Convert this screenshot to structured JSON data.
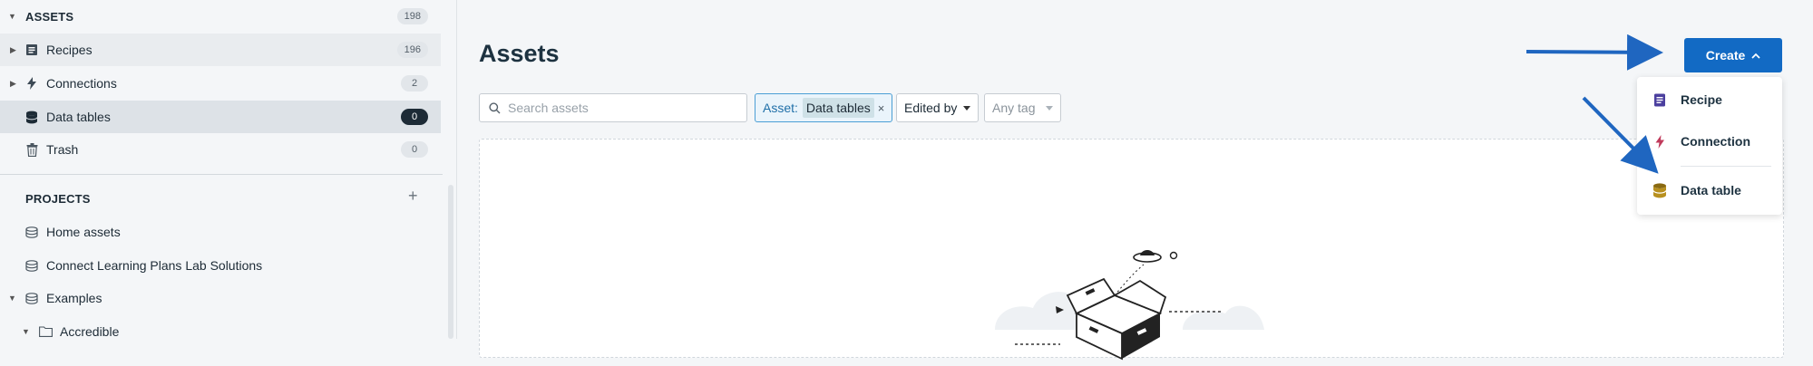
{
  "sidebar": {
    "assets_section": {
      "label": "ASSETS",
      "count": "198"
    },
    "items": [
      {
        "label": "Recipes",
        "count": "196"
      },
      {
        "label": "Connections",
        "count": "2"
      },
      {
        "label": "Data tables",
        "count": "0"
      },
      {
        "label": "Trash",
        "count": "0"
      }
    ],
    "projects_section": {
      "label": "PROJECTS"
    },
    "projects": [
      {
        "label": "Home assets"
      },
      {
        "label": "Connect Learning Plans Lab Solutions"
      },
      {
        "label": "Examples"
      },
      {
        "label": "Accredible"
      }
    ]
  },
  "main": {
    "title": "Assets",
    "search": {
      "placeholder": "Search assets"
    },
    "filters": {
      "asset_key": "Asset:",
      "asset_value": "Data tables",
      "remove_glyph": "×",
      "edited_by": "Edited by",
      "any_tag": "Any tag"
    }
  },
  "create": {
    "label": "Create",
    "menu": [
      {
        "label": "Recipe",
        "icon": "recipe-icon"
      },
      {
        "label": "Connection",
        "icon": "connection-icon"
      },
      {
        "label": "Data table",
        "icon": "data-table-icon"
      }
    ]
  },
  "colors": {
    "primary": "#126ac4",
    "arrow": "#1f66c0",
    "selected_badge": "#1d2b36"
  }
}
